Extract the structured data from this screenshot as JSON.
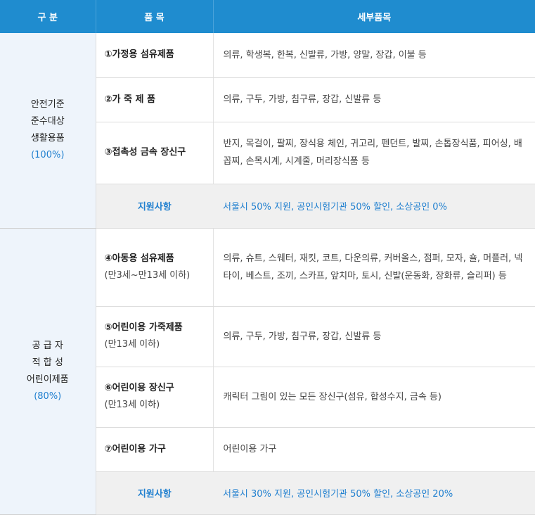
{
  "header": {
    "col1": "구 분",
    "col2": "품 목",
    "col3": "세부품목"
  },
  "groups": [
    {
      "label_lines": [
        "안전기준",
        "준수대상",
        "생활용품"
      ],
      "percent": "(100%)",
      "items": [
        {
          "name": "①가정용 섬유제품",
          "sub": "",
          "detail": "의류, 학생복, 한복, 신발류, 가방, 양말, 장갑, 이불 등"
        },
        {
          "name": "②가 죽 제 품",
          "sub": "",
          "detail": "의류, 구두, 가방, 침구류, 장갑, 신발류 등"
        },
        {
          "name": "③접촉성 금속 장신구",
          "sub": "",
          "detail": "반지, 목걸이, 팔찌, 장식용 체인, 귀고리, 펜던트, 발찌, 손톱장식품, 피어싱, 배꼽찌, 손목시계, 시계줄, 머리장식품 등"
        }
      ],
      "support": {
        "label": "지원사항",
        "value": "서울시 50% 지원, 공인시험기관 50% 할인, 소상공인 0%"
      }
    },
    {
      "label_lines": [
        "공 급 자",
        "적 합 성",
        "어린이제품"
      ],
      "percent": "(80%)",
      "items": [
        {
          "name": "④아동용 섬유제품",
          "sub": "(만3세~만13세 이하)",
          "detail": "의류, 슈트, 스웨터, 재킷, 코트, 다운의류, 커버올스, 점퍼, 모자, 숄, 머플러, 넥타이, 베스트, 조끼, 스카프, 앞치마, 토시, 신발(운동화, 장화류, 슬리퍼) 등"
        },
        {
          "name": "⑤어린이용 가죽제품",
          "sub": "(만13세 이하)",
          "detail": "의류, 구두, 가방, 침구류, 장갑, 신발류 등"
        },
        {
          "name": "⑥어린이용 장신구",
          "sub": "(만13세 이하)",
          "detail": "캐릭터 그림이 있는 모든 장신구(섬유, 합성수지, 금속 등)"
        },
        {
          "name": "⑦어린이용 가구",
          "sub": "",
          "detail": "어린이용 가구"
        }
      ],
      "support": {
        "label": "지원사항",
        "value": "서울시 30% 지원, 공인시험기관 50% 할인, 소상공인 20%"
      }
    }
  ]
}
